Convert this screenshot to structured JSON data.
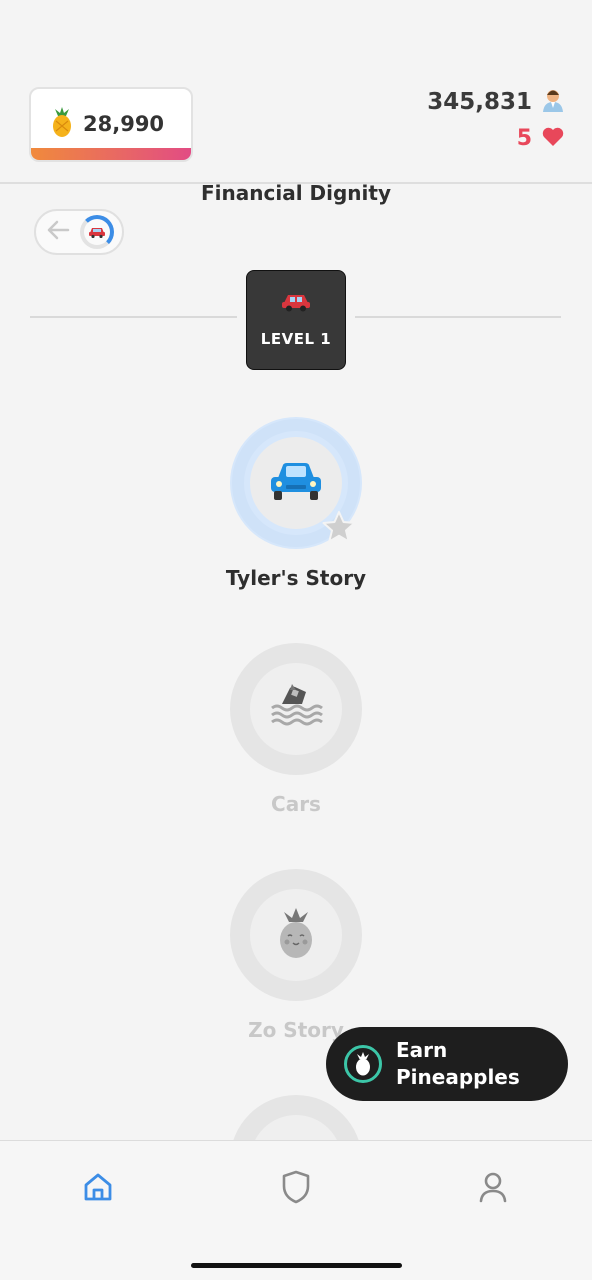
{
  "header": {
    "pineapple_count": "28,990",
    "points": "345,831",
    "hearts": "5"
  },
  "section": {
    "title": "Financial Dignity"
  },
  "level": {
    "label": "LEVEL 1"
  },
  "nodes": [
    {
      "label": "Tyler's Story",
      "state": "active",
      "icon": "blue-car-icon"
    },
    {
      "label": "Cars",
      "state": "locked",
      "icon": "sinking-car-icon"
    },
    {
      "label": "Zo Story",
      "state": "locked",
      "icon": "pineapple-face-icon"
    }
  ],
  "earn_button": {
    "label": "Earn Pineapples"
  },
  "nav": {
    "items": [
      "home-icon",
      "shield-icon",
      "profile-icon"
    ],
    "active": "home-icon"
  },
  "colors": {
    "accent_blue": "#3c8de6",
    "heart_red": "#e8475a",
    "earn_ring": "#3cc6a8"
  }
}
